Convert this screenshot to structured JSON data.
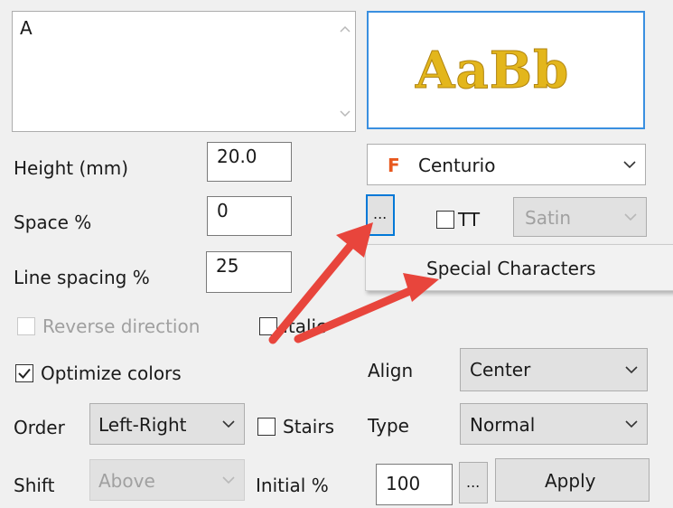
{
  "text_input": {
    "value": "A"
  },
  "preview": {
    "text": "AaBb",
    "color": "#e3b61c"
  },
  "height": {
    "label": "Height (mm)",
    "value": "20.0"
  },
  "space": {
    "label": "Space %",
    "value": "0"
  },
  "line_spacing": {
    "label": "Line spacing %",
    "value": "25"
  },
  "font_select": {
    "badge": "F",
    "badge_color": "#e8581e",
    "value": "Centurio"
  },
  "more_button": {
    "label": "..."
  },
  "tt": {
    "label": "TT",
    "checked": false
  },
  "stitch_select": {
    "value": "Satin"
  },
  "popup_menu": {
    "item": "Special Characters"
  },
  "reverse_direction": {
    "label": "Reverse direction",
    "checked": false
  },
  "italic": {
    "label": "Italic",
    "checked": false
  },
  "optimize_colors": {
    "label": "Optimize colors",
    "checked": true
  },
  "align": {
    "label": "Align",
    "value": "Center"
  },
  "order": {
    "label": "Order",
    "value": "Left-Right"
  },
  "stairs": {
    "label": "Stairs",
    "checked": false
  },
  "type": {
    "label": "Type",
    "value": "Normal"
  },
  "shift": {
    "label": "Shift",
    "value": "Above"
  },
  "initial": {
    "label": "Initial %",
    "value": "100"
  },
  "initial_more": {
    "label": "..."
  },
  "apply_button": {
    "label": "Apply"
  },
  "colors": {
    "arrow": "#e8453c",
    "focus": "#0078d7"
  }
}
